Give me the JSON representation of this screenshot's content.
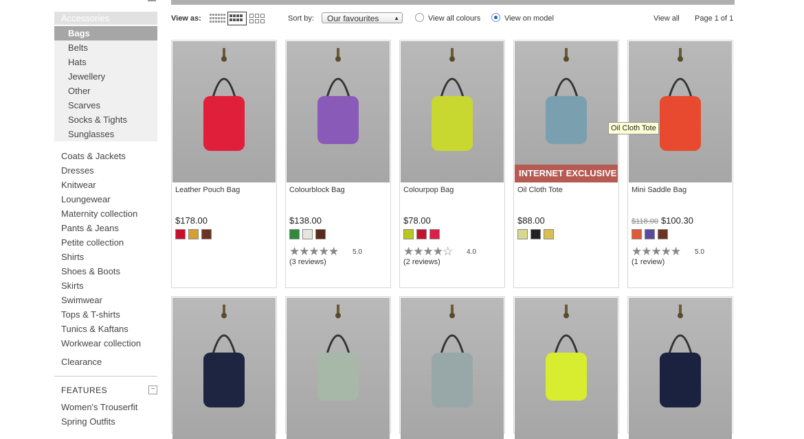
{
  "sidebar": {
    "section_title": "Accessories",
    "subcategories": [
      {
        "label": "Bags",
        "active": true
      },
      {
        "label": "Belts"
      },
      {
        "label": "Hats"
      },
      {
        "label": "Jewellery"
      },
      {
        "label": "Other"
      },
      {
        "label": "Scarves"
      },
      {
        "label": "Socks & Tights"
      },
      {
        "label": "Sunglasses"
      }
    ],
    "categories": [
      "Coats & Jackets",
      "Dresses",
      "Knitwear",
      "Loungewear",
      "Maternity collection",
      "Pants & Jeans",
      "Petite collection",
      "Shirts",
      "Shoes & Boots",
      "Skirts",
      "Swimwear",
      "Tops & T-shirts",
      "Tunics & Kaftans",
      "Workwear collection"
    ],
    "clearance": "Clearance",
    "features_title": "FEATURES",
    "features_toggle": "−",
    "features_items": [
      "Women's Trouserfit",
      "Spring Outfits"
    ]
  },
  "toolbar": {
    "view_as_label": "View as:",
    "sort_label": "Sort by:",
    "sort_value": "Our favourites",
    "radio1_label": "View all colours",
    "radio2_label": "View on model",
    "view_all": "View all",
    "page_info": "Page 1 of 1"
  },
  "products": [
    {
      "name": "Leather Pouch Bag",
      "price": "$178.00",
      "old_price": "",
      "swatches": [
        "#c8102e",
        "#d4a030",
        "#6b3322"
      ],
      "stars": "",
      "rating": "",
      "reviews": "",
      "badge": "",
      "bag": "#e0203a"
    },
    {
      "name": "Colourblock Bag",
      "price": "$138.00",
      "old_price": "",
      "swatches": [
        "#2e8b3a",
        "#e8e6dc",
        "#5a2a1a"
      ],
      "stars": "★★★★★",
      "rating": "5.0",
      "reviews": "(3 reviews)",
      "badge": "",
      "bag": "#8a5ab8"
    },
    {
      "name": "Colourpop Bag",
      "price": "$78.00",
      "old_price": "",
      "swatches": [
        "#b8c820",
        "#c8102e",
        "#d8204a"
      ],
      "stars": "★★★★☆",
      "rating": "4.0",
      "reviews": "(2 reviews)",
      "badge": "",
      "bag": "#c8d830"
    },
    {
      "name": "Oil Cloth Tote",
      "price": "$88.00",
      "old_price": "",
      "swatches": [
        "#d8d890",
        "#222222",
        "#d8c050"
      ],
      "stars": "",
      "rating": "",
      "reviews": "",
      "badge": "INTERNET EXCLUSIVE",
      "bag": "#7aa0b0"
    },
    {
      "name": "Mini Saddle Bag",
      "price": "$100.30",
      "old_price": "$118.00",
      "swatches": [
        "#e05a3a",
        "#5a4aa0",
        "#6b3322"
      ],
      "stars": "★★★★★",
      "rating": "5.0",
      "reviews": "(1 review)",
      "badge": "",
      "bag": "#e84a30"
    }
  ],
  "row2": [
    {
      "bag": "#1e2540"
    },
    {
      "bag": "#a8b8a8"
    },
    {
      "bag": "#98a8a8"
    },
    {
      "bag": "#d8ec30"
    },
    {
      "bag": "#1a2240"
    }
  ],
  "tooltip": "Oil Cloth Tote"
}
